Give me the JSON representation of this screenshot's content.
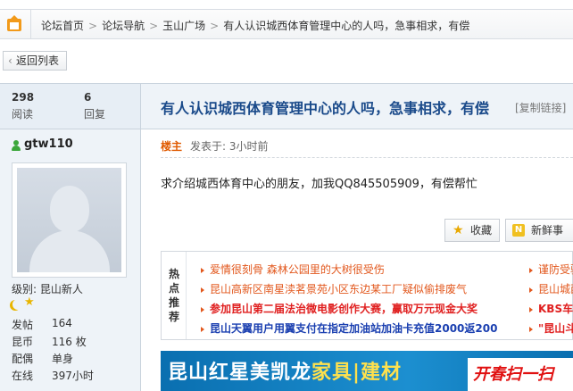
{
  "breadcrumb": {
    "items": [
      "论坛首页",
      "论坛导航",
      "玉山广场",
      "有人认识城西体育管理中心的人吗，急事相求，有偿"
    ],
    "separator": ">"
  },
  "back_button": {
    "label": "返回列表",
    "chevron": "‹"
  },
  "stats": {
    "views_num": "298",
    "views_label": "阅读",
    "replies_num": "6",
    "replies_label": "回复"
  },
  "thread": {
    "title": "有人认识城西体育管理中心的人吗，急事相求，有偿",
    "copy_link": "[复制链接]"
  },
  "user": {
    "name": "gtw110",
    "level": "级别: 昆山新人",
    "star": "★",
    "fields": [
      {
        "label": "发帖",
        "value": "164"
      },
      {
        "label": "昆币",
        "value": "116 枚"
      },
      {
        "label": "配偶",
        "value": "单身"
      },
      {
        "label": "在线",
        "value": "397小时"
      }
    ]
  },
  "post": {
    "author_tag": "楼主",
    "posted_time": "发表于: 3小时前",
    "body": "求介绍城西体育中心的朋友，加我QQ845505909，有偿帮忙"
  },
  "actions": {
    "favorite_label": "收藏",
    "favorite_icon": "★",
    "fresh_label": "新鲜事",
    "fresh_icon": "N"
  },
  "hot": {
    "label_chars": [
      "热",
      "点",
      "推",
      "荐"
    ],
    "items": [
      {
        "text": "爱情很刻骨 森林公园里的大树很受伤",
        "color": "#e2571c",
        "bold": false
      },
      {
        "text": "昆山高新区南星渎茗景苑小区东边某工厂疑似偷排废气",
        "color": "#e2571c",
        "bold": false
      },
      {
        "text": "参加昆山第二届法治微电影创作大赛，赢取万元现金大奖",
        "color": "#e02020",
        "bold": true
      },
      {
        "text": "昆山天翼用户用翼支付在指定加油站加油卡充值2000返200",
        "color": "#1a3fb0",
        "bold": true
      }
    ],
    "right_items": [
      {
        "text": "谨防受骗",
        "color": "#e2571c",
        "bold": false
      },
      {
        "text": "昆山城西",
        "color": "#e2571c",
        "bold": false
      },
      {
        "text": "KBS车友",
        "color": "#e02020",
        "bold": true
      },
      {
        "text": "\"昆山斗",
        "color": "#e02020",
        "bold": true
      }
    ]
  },
  "banner": {
    "part1": "昆山红星美凯龙",
    "part2": "家具",
    "part3": "|建材",
    "right": "开春扫一扫"
  }
}
